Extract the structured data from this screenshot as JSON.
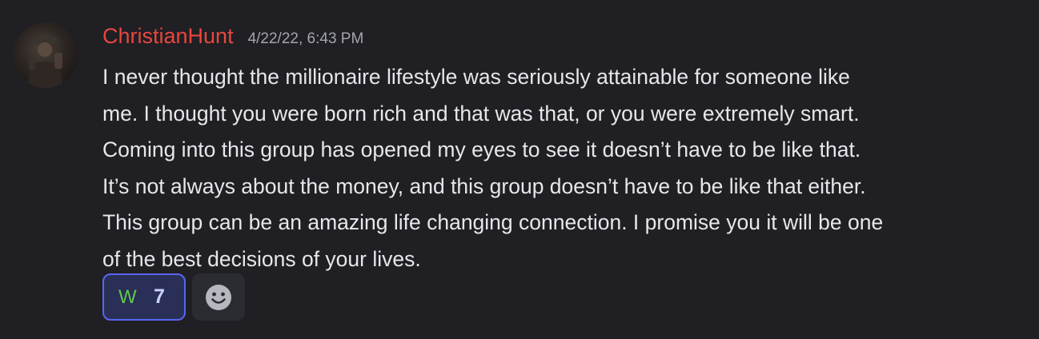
{
  "message": {
    "author": "ChristianHunt",
    "timestamp": "4/22/22, 6:43 PM",
    "lines": [
      "I never thought the millionaire lifestyle was seriously attainable for someone like",
      "me. I thought you were born rich and that was that, or you were extremely smart.",
      "Coming into this group has opened my eyes to see it doesn’t have to be like that.",
      "It’s not always about the money, and this group doesn’t have to be like that either.",
      "This group can be an amazing life changing connection. I promise you it will be one",
      "of the best decisions of your lives."
    ]
  },
  "reactions": [
    {
      "emoji": "W",
      "count": "7",
      "selected": true
    }
  ],
  "add_reaction_icon": "smiley-face-icon",
  "colors": {
    "background": "#1f1f24",
    "username": "#e8473d",
    "text": "#e6e7ea",
    "timestamp": "#a3a6ad",
    "reaction_border": "#5866f2",
    "reaction_bg": "#2a2f58",
    "reaction_emoji": "#62c84a"
  }
}
